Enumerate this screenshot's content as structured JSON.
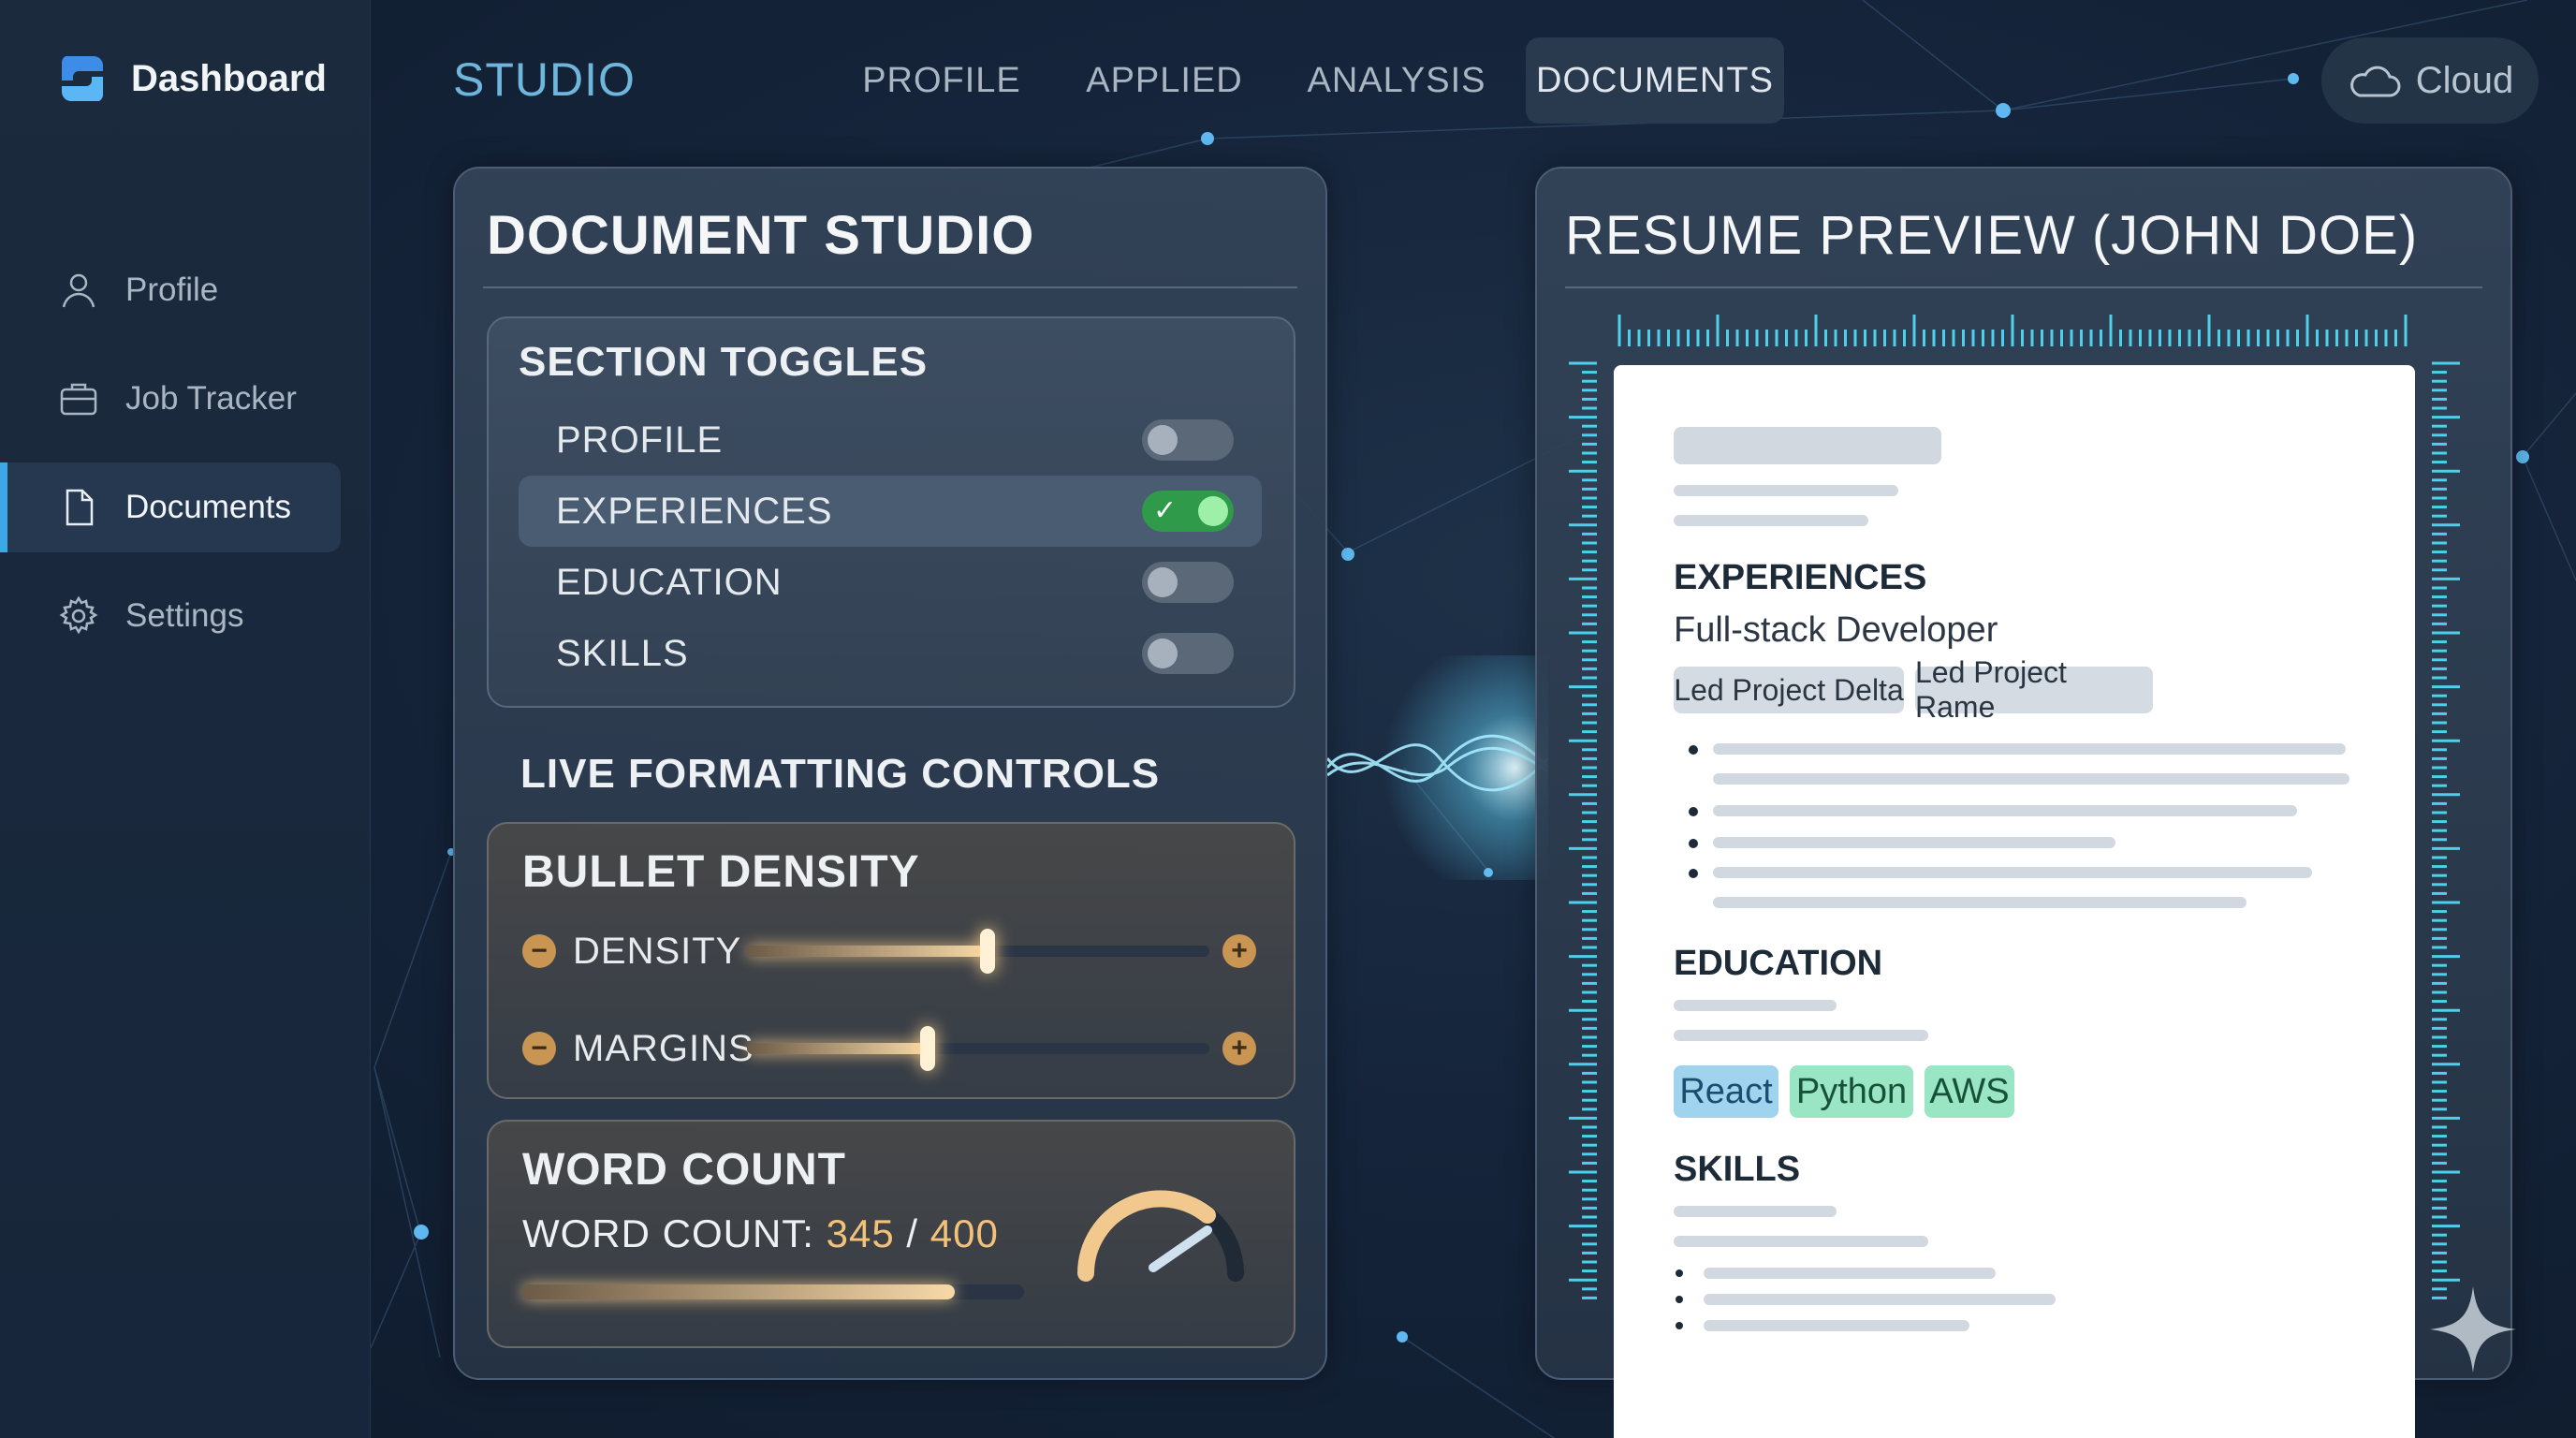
{
  "sidebar": {
    "brand": "Dashboard",
    "items": [
      {
        "label": "Profile",
        "icon": "user-icon"
      },
      {
        "label": "Job Tracker",
        "icon": "briefcase-icon"
      },
      {
        "label": "Documents",
        "icon": "document-icon",
        "active": true
      },
      {
        "label": "Settings",
        "icon": "gear-icon"
      }
    ]
  },
  "header": {
    "title": "STUDIO",
    "tabs": [
      {
        "label": "PROFILE"
      },
      {
        "label": "APPLIED"
      },
      {
        "label": "ANALYSIS"
      },
      {
        "label": "DOCUMENTS",
        "active": true
      }
    ],
    "cloud_label": "Cloud"
  },
  "studio": {
    "title": "DOCUMENT STUDIO",
    "toggles_heading": "SECTION TOGGLES",
    "toggles": [
      {
        "label": "PROFILE",
        "on": false
      },
      {
        "label": "EXPERIENCES",
        "on": true
      },
      {
        "label": "EDUCATION",
        "on": false
      },
      {
        "label": "SKILLS",
        "on": false
      }
    ],
    "formatting_heading": "LIVE FORMATTING CONTROLS",
    "bullet_density": {
      "heading": "BULLET DENSITY",
      "sliders": [
        {
          "label": "DENSITY",
          "value_fraction": 0.52
        },
        {
          "label": "MARGINS",
          "value_fraction": 0.39
        }
      ]
    },
    "word_count": {
      "heading": "WORD COUNT",
      "prefix": "WORD COUNT:",
      "current": "345",
      "separator": "/",
      "max": "400",
      "progress_fraction": 0.8625
    }
  },
  "preview": {
    "title": "RESUME PREVIEW (JOHN DOE)",
    "experiences_heading": "EXPERIENCES",
    "job_title": "Full-stack Developer",
    "project_chips": [
      "Led Project Delta",
      "Led Project Rame"
    ],
    "education_heading": "EDUCATION",
    "skill_chips": [
      "React",
      "Python",
      "AWS"
    ],
    "skills_heading": "SKILLS"
  },
  "colors": {
    "accent": "#3ea8e6",
    "toggle_on": "#2f9a4a",
    "slider_glow": "#f7d9a8",
    "word_count_number": "#f3c27a"
  }
}
